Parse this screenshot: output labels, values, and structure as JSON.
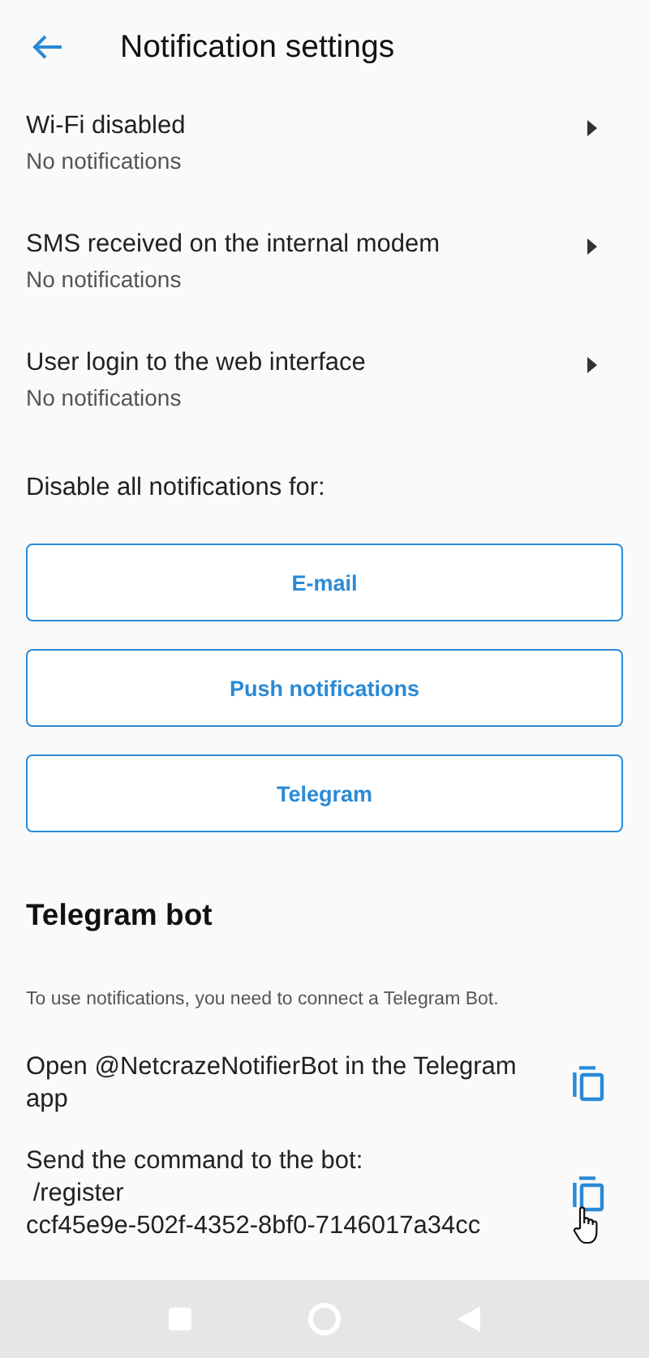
{
  "header": {
    "title": "Notification settings"
  },
  "events": [
    {
      "title": "Wi-Fi disabled",
      "status": "No notifications"
    },
    {
      "title": "SMS received on the internal modem",
      "status": "No notifications"
    },
    {
      "title": "User login to the web interface",
      "status": "No notifications"
    }
  ],
  "disable_all": {
    "label": "Disable all notifications for:",
    "buttons": [
      "E-mail",
      "Push notifications",
      "Telegram"
    ]
  },
  "telegram_bot": {
    "heading": "Telegram bot",
    "hint": "To use notifications, you need to connect a Telegram Bot.",
    "steps": [
      {
        "text": "Open @NetcrazeNotifierBot in the Telegram app"
      },
      {
        "text": "Send the command to the bot:\n /register\nccf45e9e-502f-4352-8bf0-7146017a34cc",
        "cursor": true
      }
    ]
  }
}
